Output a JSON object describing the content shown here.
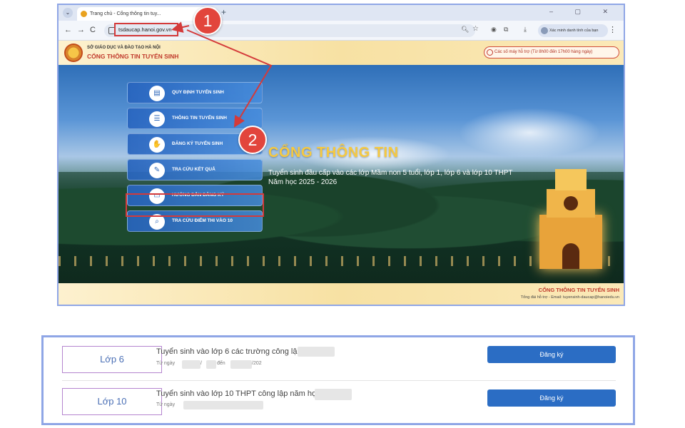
{
  "browser": {
    "tab_title": "Trang chủ - Cổng thông tin tuy...",
    "tab_close": "×",
    "new_tab": "+",
    "window_controls": "– ▢ ✕",
    "nav": {
      "back": "←",
      "forward": "→",
      "reload": "C"
    },
    "url": "tsdaucap.hanoi.gov.vn",
    "account_chip": "Xác minh danh tính của bạn",
    "kebab": "⋮"
  },
  "site": {
    "dept": "SỞ GIÁO DỤC VÀ ĐÀO TẠO HÀ NỘI",
    "portal_name": "CỔNG THÔNG TIN TUYỂN SINH",
    "hotline": "Các số máy hỗ trợ (Từ 8h00 đến 17h00 hàng ngày)",
    "hero_title": "CỔNG THÔNG TIN",
    "hero_subtitle": "Tuyển sinh đầu cấp vào các lớp Mầm non 5 tuổi, lớp 1, lớp 6 và lớp 10 THPT",
    "hero_year": "Năm học 2025 - 2026",
    "menu": [
      {
        "label": "QUY ĐỊNH TUYỂN SINH",
        "icon": "clipboard-icon"
      },
      {
        "label": "THÔNG TIN TUYỂN SINH",
        "icon": "document-icon"
      },
      {
        "label": "ĐĂNG KÝ TUYỂN SINH",
        "icon": "hand-register-icon"
      },
      {
        "label": "TRA CỨU KẾT QUẢ",
        "icon": "result-icon"
      },
      {
        "label": "HƯỚNG DẪN ĐĂNG KÝ",
        "icon": "laptop-guide-icon"
      },
      {
        "label": "TRA CỨU ĐIỂM THI VÀO 10",
        "icon": "search-icon"
      }
    ],
    "footer_portal": "CỔNG THÔNG TIN TUYỂN SINH",
    "footer_contact": "Tổng đài hỗ trợ - Email: tuyensinh-daucap@hanoiedu.vn"
  },
  "steps": [
    "1",
    "2"
  ],
  "registration": {
    "rows": [
      {
        "grade": "Lớp 6",
        "title": "Tuyển sinh vào lớp 6 các trường công lập",
        "date_prefix": "Từ ngày",
        "date_mid": "/",
        "date_to": "đến",
        "date_end": "/202",
        "button": "Đăng ký"
      },
      {
        "grade": "Lớp 10",
        "title": "Tuyển sinh vào lớp 10 THPT công lập năm học",
        "date_prefix": "Từ ngày",
        "button": "Đăng ký"
      }
    ]
  },
  "colors": {
    "highlight_red": "#d43a3a",
    "step_badge": "#e2453c",
    "register_button": "#2b6dc4",
    "hero_title": "#f6c940",
    "portal_red": "#c0392b"
  }
}
